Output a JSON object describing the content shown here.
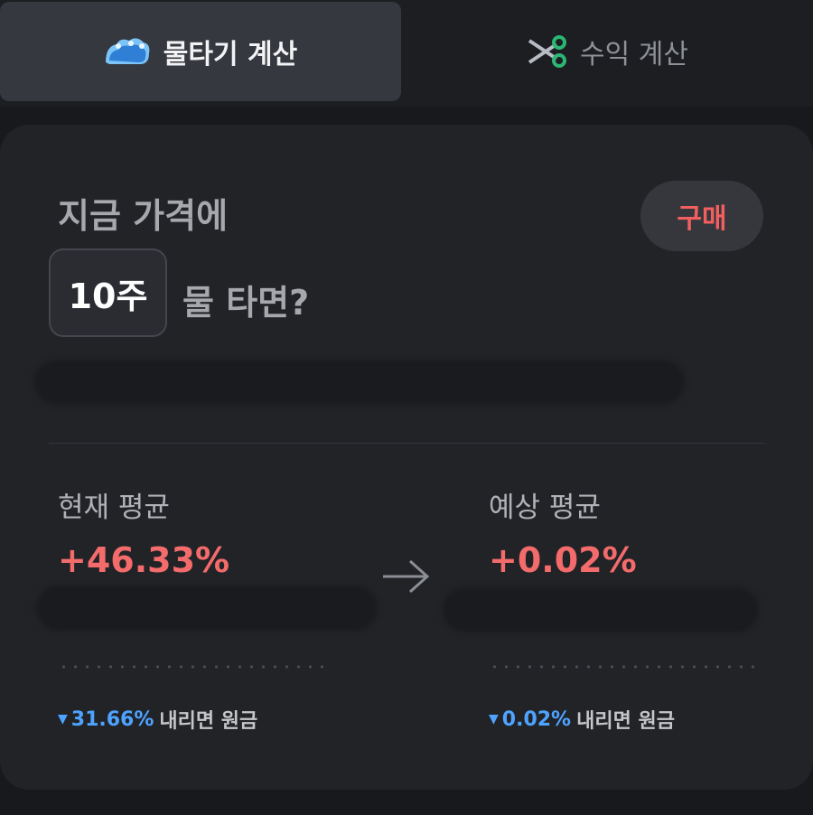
{
  "tabs": {
    "active": {
      "label": "물타기 계산",
      "icon": "water-wave-icon"
    },
    "inactive": {
      "label": "수익 계산",
      "icon": "scissors-icon"
    }
  },
  "card": {
    "question_line1": "지금 가격에",
    "buy_label": "구매",
    "quantity": "10주",
    "question_line2": "물 타면?",
    "current": {
      "label": "현재 평균",
      "percent": "+46.33%",
      "footer_percent": "31.66%",
      "footer_text": "내리면 원금"
    },
    "expected": {
      "label": "예상 평균",
      "percent": "+0.02%",
      "footer_percent": "0.02%",
      "footer_text": "내리면 원금"
    }
  },
  "colors": {
    "positive": "#f36b6b",
    "negative": "#4ea3ff",
    "card_bg": "#212327"
  }
}
